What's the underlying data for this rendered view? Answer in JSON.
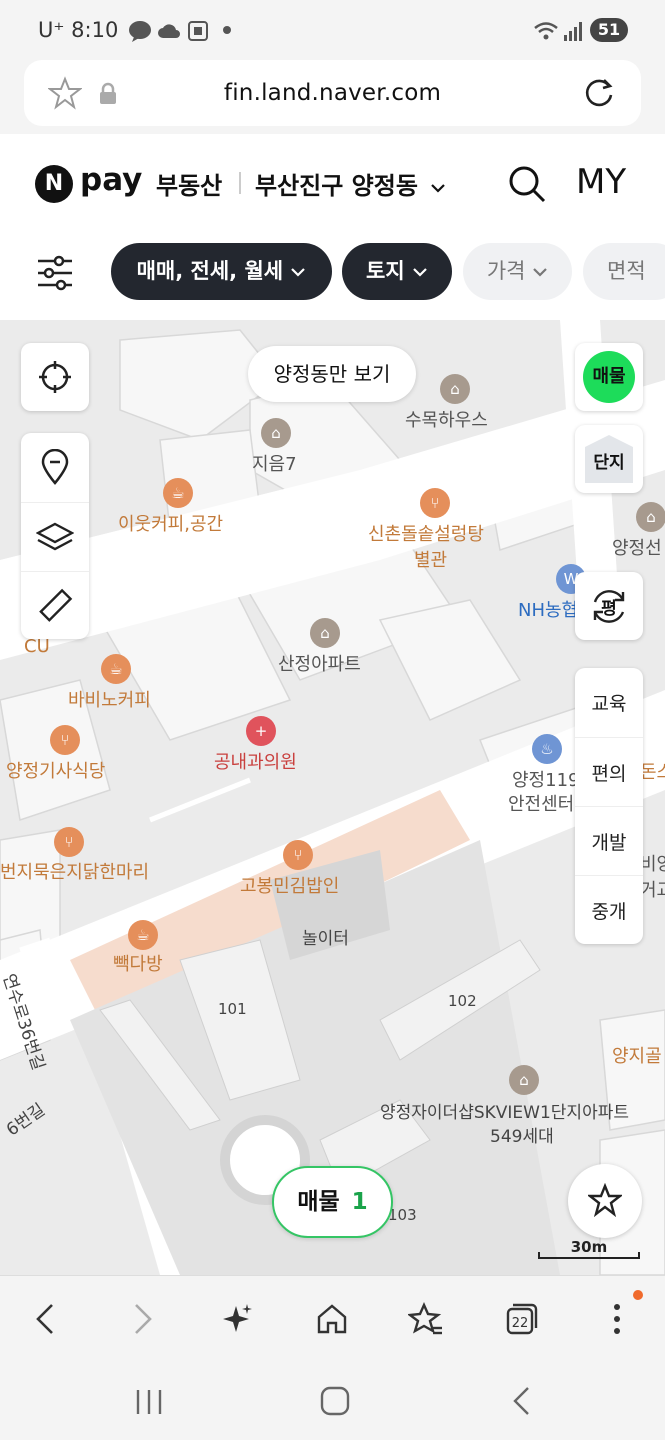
{
  "status_bar": {
    "carrier": "U⁺",
    "time": "8:10",
    "battery": "51"
  },
  "url_bar": {
    "url": "fin.land.naver.com"
  },
  "header": {
    "brand_n": "N",
    "brand_pay": "pay",
    "brand_service": "부동산",
    "region": "부산진구 양정동",
    "my": "MY"
  },
  "filters": [
    {
      "label": "매매, 전세, 월세"
    },
    {
      "label": "토지"
    },
    {
      "label": "가격"
    },
    {
      "label": "면적"
    }
  ],
  "map": {
    "only_region_button": "양정동만 보기",
    "pois": [
      "수목하우스",
      "지음7",
      "이웃커피,공간",
      "신촌돌솥설렁탕",
      "별관",
      "양정선",
      "NH농협",
      "산정아파트",
      "CU",
      "바비노커피",
      "공내과의원",
      "양정기사식당",
      "양정119",
      "안전센터",
      "돈스",
      "비양",
      "거교",
      "번지묵은지닭한마리",
      "고봉민김밥인",
      "놀이터",
      "빽다방",
      "101",
      "102",
      "103",
      "연수로36번길",
      "양지골",
      "양정자이더샵SKVIEW1단지아파트",
      "549세대",
      "6번길"
    ],
    "right_buttons": {
      "listing": "매물",
      "complex": "단지",
      "pyeong": "평"
    },
    "layers": [
      "교육",
      "편의",
      "개발",
      "중개"
    ],
    "listing_count": {
      "label": "매물",
      "count": "1"
    },
    "scale": "30m"
  },
  "colors": {
    "listing_green": "#1ddc5a",
    "count_green": "#1aa34a",
    "chip_dark": "#23272f"
  },
  "notification_dot": "#f06a2c"
}
